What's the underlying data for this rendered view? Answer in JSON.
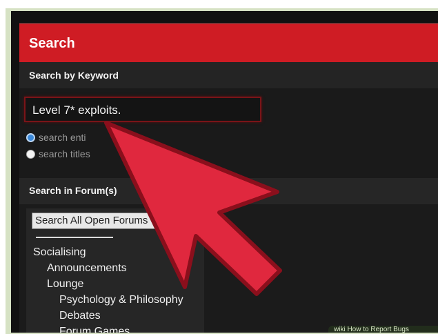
{
  "header": {
    "title": "Search"
  },
  "keyword_section": {
    "label": "Search by Keyword",
    "input_value": "Level 7* exploits.",
    "options": [
      {
        "label": "search enti",
        "selected": true
      },
      {
        "label": "search titles",
        "selected": false
      }
    ]
  },
  "forum_section": {
    "label": "Search in Forum(s)",
    "select_value": "Search All Open Forums",
    "items": [
      {
        "label": "Socialising",
        "level": 0
      },
      {
        "label": "Announcements",
        "level": 1
      },
      {
        "label": "Lounge",
        "level": 1
      },
      {
        "label": "Psychology & Philosophy",
        "level": 2
      },
      {
        "label": "Debates",
        "level": 2
      },
      {
        "label": "Forum Games",
        "level": 2
      }
    ]
  },
  "overlay": {
    "arrow_color": "#e0283e"
  },
  "watermark": {
    "text": "wiki How to Report Bugs"
  }
}
